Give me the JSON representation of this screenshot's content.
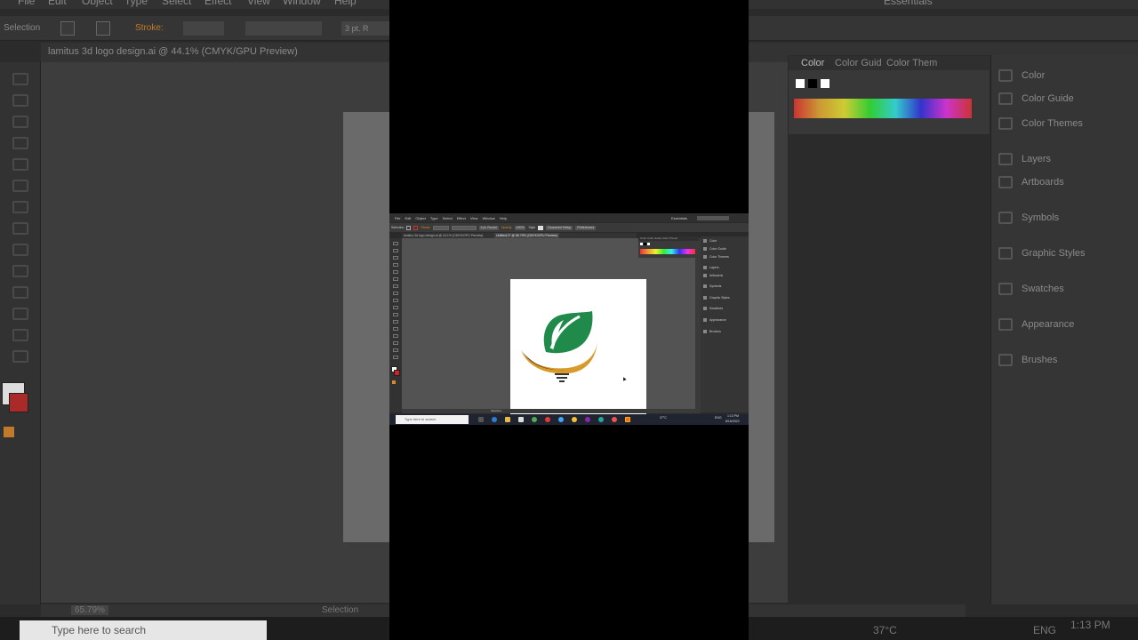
{
  "background": {
    "menus": [
      "File",
      "Edit",
      "Object",
      "Type",
      "Select",
      "Effect",
      "View",
      "Window",
      "Help"
    ],
    "workspace": "Essentials",
    "control_bar": {
      "mode": "Selection",
      "stroke_label": "Stroke:",
      "brush": "3 pt. R"
    },
    "tabs": [
      "lamitus 3d logo design.ai @ 44.1% (CMYK/GPU Preview)",
      "Untitled-2*"
    ],
    "color_panel_tabs": [
      "Color",
      "Color Guid",
      "Color Them"
    ],
    "dock_items": [
      "Color",
      "Color Guide",
      "Color Themes",
      "Layers",
      "Artboards",
      "Symbols",
      "Graphic Styles",
      "Swatches",
      "Appearance",
      "Brushes"
    ],
    "status_zoom": "65.79%",
    "status_mode": "Selection",
    "taskbar_search": "Type here to search",
    "temperature": "37°C",
    "language": "ENG",
    "time": "1:13 PM"
  },
  "inner": {
    "menus": [
      "File",
      "Edit",
      "Object",
      "Type",
      "Select",
      "Effect",
      "View",
      "Window",
      "Help"
    ],
    "workspace": "Essentials",
    "control_bar": {
      "mode": "Selection",
      "stroke": "Stroke",
      "brush": "3 pt. Round",
      "opacity": "Opacity",
      "opacity_val": "100%",
      "style": "Style",
      "doc_setup": "Document Setup",
      "preferences": "Preferences"
    },
    "tabs": [
      "lamitus 3d logo design.ai @ 44.1% (CMYK/GPU Preview)",
      "Untitled-2* @ 66.79% (CMYK/GPU Preview)"
    ],
    "color_panel_tabs": "Color  Color Guide  Color Theme",
    "dock_items": [
      "Color",
      "Color Guide",
      "Color Themes",
      "Layers",
      "Artboards",
      "Symbols",
      "Graphic Styles",
      "Swatches",
      "Appearance",
      "Brushes"
    ],
    "status_mode": "Selection",
    "taskbar_search": "Type here to search",
    "temperature": "37°C",
    "language": "ENG",
    "time": "1:13 PM",
    "date": "8/16/2022"
  },
  "colors": {
    "leaf_green": "#1f8a4a",
    "arc_orange": "#d89a2a",
    "arc_dark": "#3a2a1a",
    "bulb_base": "#333333"
  }
}
